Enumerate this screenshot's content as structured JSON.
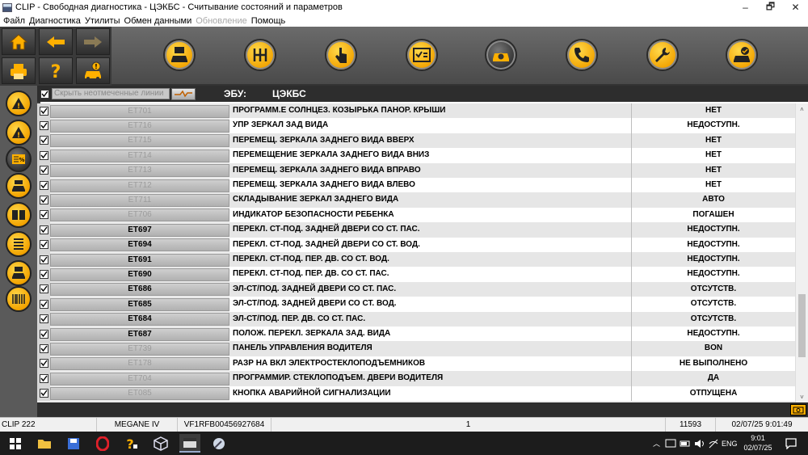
{
  "window": {
    "title": "CLIP - Свободная диагностика - ЦЭКБС - Считывание состояний и параметров",
    "minimize": "–",
    "maximize": "🗗",
    "close": "✕"
  },
  "menu": [
    {
      "label": "Файл",
      "enabled": true
    },
    {
      "label": "Диагностика",
      "enabled": true
    },
    {
      "label": "Утилиты",
      "enabled": true
    },
    {
      "label": "Обмен данными",
      "enabled": true
    },
    {
      "label": "Обновление",
      "enabled": false
    },
    {
      "label": "Помощь",
      "enabled": true
    }
  ],
  "toolbar": {
    "icons": [
      "home-icon",
      "back-arrow-icon",
      "forward-arrow-icon",
      "print-icon",
      "help-icon",
      "vehicle-alert-icon",
      "vehicle-info-icon",
      "gearbox-icon",
      "touch-icon",
      "checklist-icon",
      "vehicle-diagnostic-icon",
      "phone-icon",
      "wrench-icon",
      "vehicle-check-icon"
    ],
    "accent": "#f2a300"
  },
  "sidebar": {
    "icons": [
      "warning-icon",
      "warning-icon-2",
      "parameters-icon",
      "vehicle-list-icon",
      "book-icon",
      "menu-list-icon",
      "vehicle-print-icon",
      "barcode-icon"
    ]
  },
  "header": {
    "hide_unchecked": "Скрыть неотмеченные линии",
    "ebu_label": "ЭБУ:",
    "ebu_value": "ЦЭКБС"
  },
  "rows": [
    {
      "code": "ET701",
      "name": "ПРОГРАММ.Е СОЛНЦЕЗ. КОЗЫРЬКА ПАНОР. КРЫШИ",
      "value": "НЕТ",
      "active": false
    },
    {
      "code": "ET716",
      "name": "УПР ЗЕРКАЛ ЗАД ВИДА",
      "value": "НЕДОСТУПН.",
      "active": false
    },
    {
      "code": "ET715",
      "name": "ПЕРЕМЕЩ. ЗЕРКАЛА ЗАДНЕГО ВИДА ВВЕРХ",
      "value": "НЕТ",
      "active": false
    },
    {
      "code": "ET714",
      "name": "ПЕРЕМЕЩЕНИЕ ЗЕРКАЛА ЗАДНЕГО ВИДА ВНИЗ",
      "value": "НЕТ",
      "active": false
    },
    {
      "code": "ET713",
      "name": "ПЕРЕМЕЩ. ЗЕРКАЛА ЗАДНЕГО ВИДА ВПРАВО",
      "value": "НЕТ",
      "active": false
    },
    {
      "code": "ET712",
      "name": "ПЕРЕМЕЩ. ЗЕРКАЛА ЗАДНЕГО ВИДА ВЛЕВО",
      "value": "НЕТ",
      "active": false
    },
    {
      "code": "ET711",
      "name": "СКЛАДЫВАНИЕ ЗЕРКАЛ ЗАДНЕГО ВИДА",
      "value": "АВТО",
      "active": false
    },
    {
      "code": "ET706",
      "name": "ИНДИКАТОР БЕЗОПАСНОСТИ РЕБЕНКА",
      "value": "ПОГАШЕН",
      "active": false
    },
    {
      "code": "ET697",
      "name": "ПЕРЕКЛ. СТ-ПОД. ЗАДНЕЙ ДВЕРИ СО СТ. ПАС.",
      "value": "НЕДОСТУПН.",
      "active": true
    },
    {
      "code": "ET694",
      "name": "ПЕРЕКЛ. СТ-ПОД. ЗАДНЕЙ ДВЕРИ СО СТ. ВОД.",
      "value": "НЕДОСТУПН.",
      "active": true
    },
    {
      "code": "ET691",
      "name": "ПЕРЕКЛ. СТ-ПОД. ПЕР. ДВ. СО СТ. ВОД.",
      "value": "НЕДОСТУПН.",
      "active": true
    },
    {
      "code": "ET690",
      "name": "ПЕРЕКЛ. СТ-ПОД. ПЕР. ДВ. СО СТ. ПАС.",
      "value": "НЕДОСТУПН.",
      "active": true
    },
    {
      "code": "ET686",
      "name": "ЭЛ-СТ/ПОД. ЗАДНЕЙ ДВЕРИ СО СТ. ПАС.",
      "value": "ОТСУТСТВ.",
      "active": true
    },
    {
      "code": "ET685",
      "name": "ЭЛ-СТ/ПОД. ЗАДНЕЙ ДВЕРИ СО СТ. ВОД.",
      "value": "ОТСУТСТВ.",
      "active": true
    },
    {
      "code": "ET684",
      "name": "ЭЛ-СТ/ПОД. ПЕР. ДВ. СО СТ. ПАС.",
      "value": "ОТСУТСТВ.",
      "active": true
    },
    {
      "code": "ET687",
      "name": "ПОЛОЖ. ПЕРЕКЛ. ЗЕРКАЛА ЗАД. ВИДА",
      "value": "НЕДОСТУПН.",
      "active": true
    },
    {
      "code": "ET739",
      "name": "ПАНЕЛЬ УПРАВЛЕНИЯ ВОДИТЕЛЯ",
      "value": "BON",
      "active": false
    },
    {
      "code": "ET178",
      "name": "РАЗР НА ВКЛ ЭЛЕКТРОСТЕКЛОПОДЪЕМНИКОВ",
      "value": "НЕ ВЫПОЛНЕНО",
      "active": false
    },
    {
      "code": "ET704",
      "name": "ПРОГРАММИР. СТЕКЛОПОДЪЕМ. ДВЕРИ ВОДИТЕЛЯ",
      "value": "ДА",
      "active": false
    },
    {
      "code": "ET085",
      "name": "КНОПКА АВАРИЙНОЙ СИГНАЛИЗАЦИИ",
      "value": "ОТПУЩЕНА",
      "active": false
    }
  ],
  "scroll": {
    "up": "˄",
    "down": "˅"
  },
  "statusbar": {
    "device": "CLIP 222",
    "model": "MEGANE IV",
    "vin": "VF1RFB00456927684",
    "page": "1",
    "code": "11593",
    "datetime": "02/07/25 9:01:49"
  },
  "taskbar": {
    "apps": [
      "windows-start-icon",
      "file-explorer-icon",
      "save-app-icon",
      "opera-icon",
      "clip-help-icon",
      "package-icon",
      "clip-app-icon",
      "tool-app-icon"
    ],
    "lang": "ENG",
    "time": "9:01",
    "date": "02/07/25"
  }
}
